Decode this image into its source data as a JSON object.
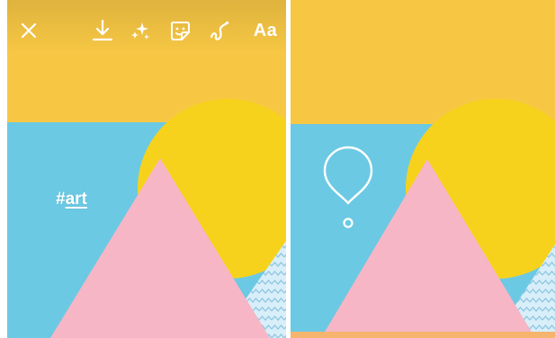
{
  "colors": {
    "yellow_top": "#f7c744",
    "cyan": "#6cc9e3",
    "yellow_circle": "#f7d21c",
    "pink": "#f6b6c6",
    "zigzag_bg": "#d8eef8",
    "zigzag_line": "#8ec6e2",
    "peach_strip": "#f6b46e",
    "white": "#ffffff"
  },
  "toolbar": {
    "close_icon": "close-icon",
    "download_icon": "download-icon",
    "effects_icon": "sparkles-icon",
    "sticker_icon": "sticker-icon",
    "draw_icon": "draw-icon",
    "text_tool_label": "Aa"
  },
  "left_story": {
    "hashtag_text": "#art",
    "hashtag_prefix": "#",
    "hashtag_word": "art"
  },
  "right_story": {
    "location_pin_icon": "map-pin-outline-icon",
    "pin_dot_icon": "circle-outline-icon"
  }
}
